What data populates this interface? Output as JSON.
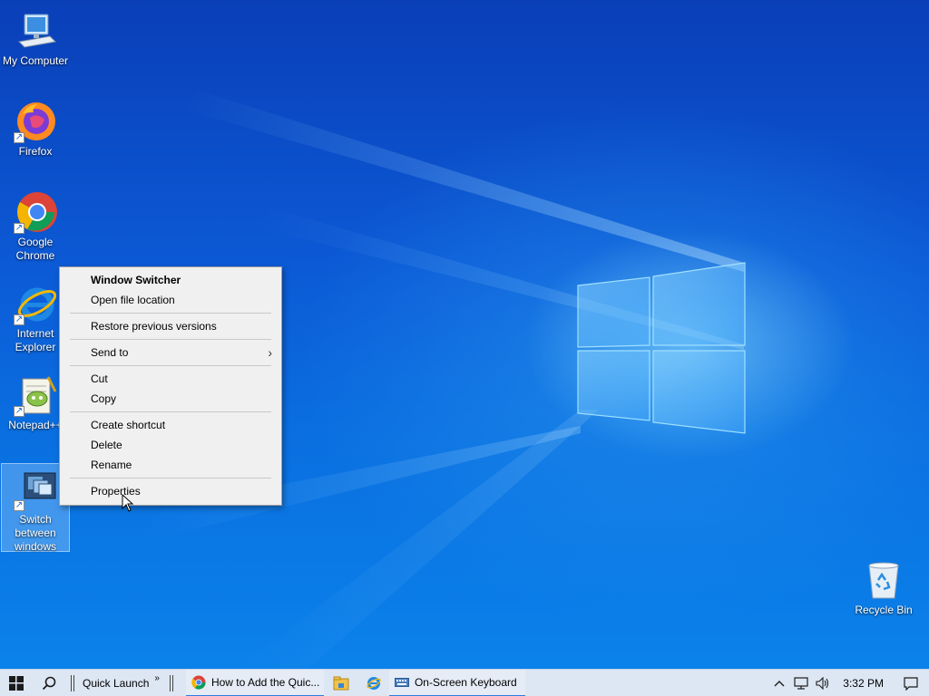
{
  "desktop": {
    "icons": [
      {
        "label_lines": [
          "My Computer"
        ]
      },
      {
        "label_lines": [
          "Firefox"
        ]
      },
      {
        "label_lines": [
          "Google",
          "Chrome"
        ]
      },
      {
        "label_lines": [
          "Internet",
          "Explorer"
        ]
      },
      {
        "label_lines": [
          "Notepad++"
        ]
      },
      {
        "label_lines": [
          "Switch",
          "between",
          "windows"
        ]
      },
      {
        "label_lines": [
          "Recycle Bin"
        ]
      }
    ]
  },
  "context_menu": {
    "title": "Window Switcher",
    "open_file_location": "Open file location",
    "restore_previous_versions": "Restore previous versions",
    "send_to": "Send to",
    "cut": "Cut",
    "copy": "Copy",
    "create_shortcut": "Create shortcut",
    "delete": "Delete",
    "rename": "Rename",
    "properties": "Properties"
  },
  "taskbar": {
    "quick_launch_label": "Quick Launch",
    "chevron": "»",
    "tasks": [
      {
        "label": "How to Add the Quic...",
        "icon": "chrome-icon"
      },
      {
        "label": "On-Screen Keyboard",
        "icon": "keyboard-icon"
      }
    ],
    "clock": "3:32 PM"
  },
  "colors": {
    "desktop_blue": "#0c5ad6",
    "taskbar_bg": "#dde6f3",
    "menu_bg": "#f0f0f0",
    "active_task_underline": "#2a7de1"
  }
}
